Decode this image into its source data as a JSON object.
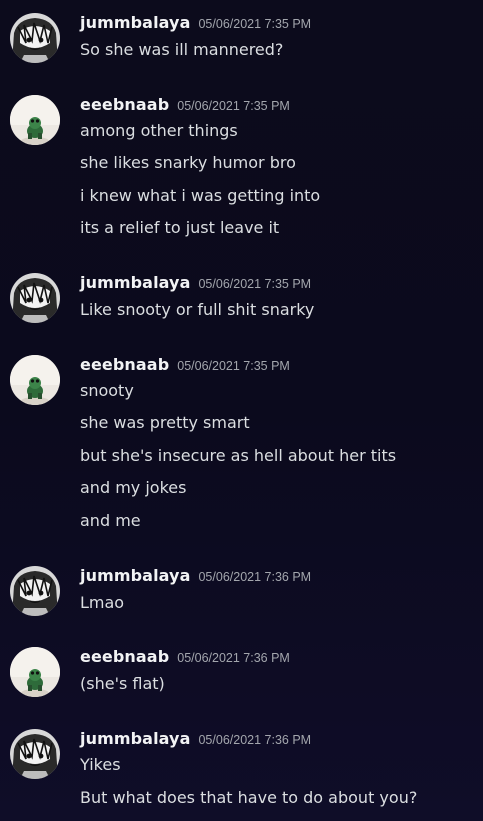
{
  "users": {
    "jummbalaya": {
      "name": "jummbalaya",
      "avatar_icon": "manga-girl-avatar-icon"
    },
    "eeebnaab": {
      "name": "eeebnaab",
      "avatar_icon": "frog-figure-avatar-icon"
    }
  },
  "messages": [
    {
      "author": "jummbalaya",
      "timestamp": "05/06/2021 7:35 PM",
      "lines": [
        "So she was ill mannered?"
      ]
    },
    {
      "author": "eeebnaab",
      "timestamp": "05/06/2021 7:35 PM",
      "lines": [
        "among other things",
        "she likes snarky humor bro",
        "i knew what i was getting into",
        "its a relief to just leave it"
      ]
    },
    {
      "author": "jummbalaya",
      "timestamp": "05/06/2021 7:35 PM",
      "lines": [
        "Like snooty or full shit snarky"
      ]
    },
    {
      "author": "eeebnaab",
      "timestamp": "05/06/2021 7:35 PM",
      "lines": [
        "snooty",
        "she was pretty smart",
        "but she's insecure as hell about her tits",
        "and my jokes",
        "and me"
      ]
    },
    {
      "author": "jummbalaya",
      "timestamp": "05/06/2021 7:36 PM",
      "lines": [
        "Lmao"
      ]
    },
    {
      "author": "eeebnaab",
      "timestamp": "05/06/2021 7:36 PM",
      "lines": [
        "(she's flat)"
      ]
    },
    {
      "author": "jummbalaya",
      "timestamp": "05/06/2021 7:36 PM",
      "lines": [
        "Yikes",
        "But what does that have to do about you?"
      ]
    }
  ]
}
